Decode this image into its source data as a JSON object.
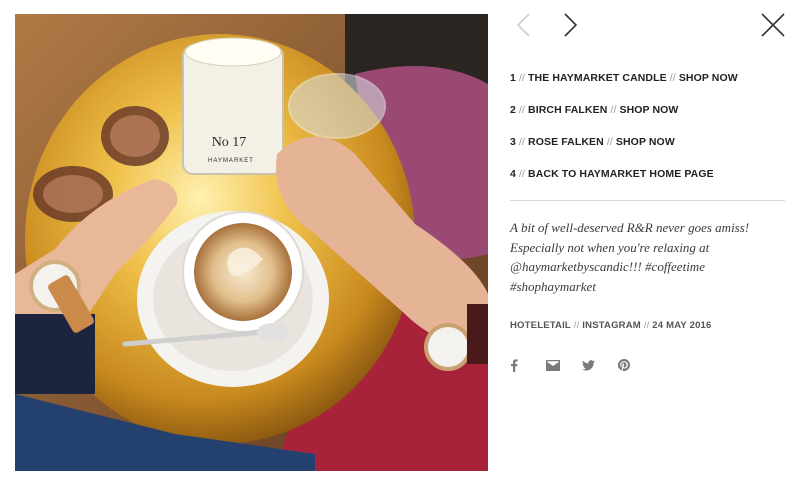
{
  "nav": {
    "prev_icon": "chevron-left-icon",
    "next_icon": "chevron-right-icon",
    "close_icon": "close-icon"
  },
  "links": [
    {
      "num": "1",
      "sep": " // ",
      "label": "THE HAYMARKET CANDLE",
      "sep2": " // ",
      "action": "SHOP NOW"
    },
    {
      "num": "2",
      "sep": " // ",
      "label": "BIRCH FALKEN",
      "sep2": " // ",
      "action": "SHOP NOW"
    },
    {
      "num": "3",
      "sep": " // ",
      "label": "ROSE FALKEN",
      "sep2": " // ",
      "action": "SHOP NOW"
    },
    {
      "num": "4",
      "sep": " // ",
      "label": "BACK TO HAYMARKET HOME PAGE",
      "sep2": "",
      "action": ""
    }
  ],
  "caption": {
    "lines": [
      "A bit of well-deserved R&R never goes amiss!",
      "Especially not when you're relaxing at",
      "@haymarketbyscandic!!! #coffeetime",
      "#shophaymarket"
    ]
  },
  "meta": {
    "author": "HOTELETAIL",
    "sep": " // ",
    "source": "INSTAGRAM",
    "date": "24 MAY 2016"
  },
  "share": [
    {
      "name": "facebook-icon"
    },
    {
      "name": "email-icon"
    },
    {
      "name": "twitter-icon"
    },
    {
      "name": "pinterest-icon"
    }
  ],
  "photo": {
    "candle_label_no": "No 17",
    "candle_label_brand": "HAYMARKET"
  },
  "colors": {
    "accent": "#222222",
    "muted": "#7a7a7a",
    "table_gold": "#d8a23a"
  }
}
